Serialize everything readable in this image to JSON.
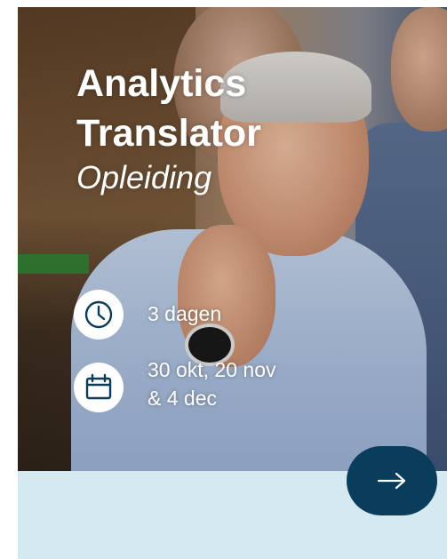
{
  "course": {
    "title_line1": "Analytics",
    "title_line2": "Translator",
    "subtitle": "Opleiding"
  },
  "details": {
    "duration": "3 dagen",
    "dates_line1": "30 okt, 20 nov",
    "dates_line2": "& 4 dec"
  },
  "icons": {
    "duration": "clock-icon",
    "dates": "calendar-icon",
    "cta": "arrow-right-icon"
  },
  "colors": {
    "band": "#d4eaf0",
    "cta_button": "#0a3d5c",
    "icon_stroke": "#0a3d5c",
    "text": "#ffffff"
  }
}
